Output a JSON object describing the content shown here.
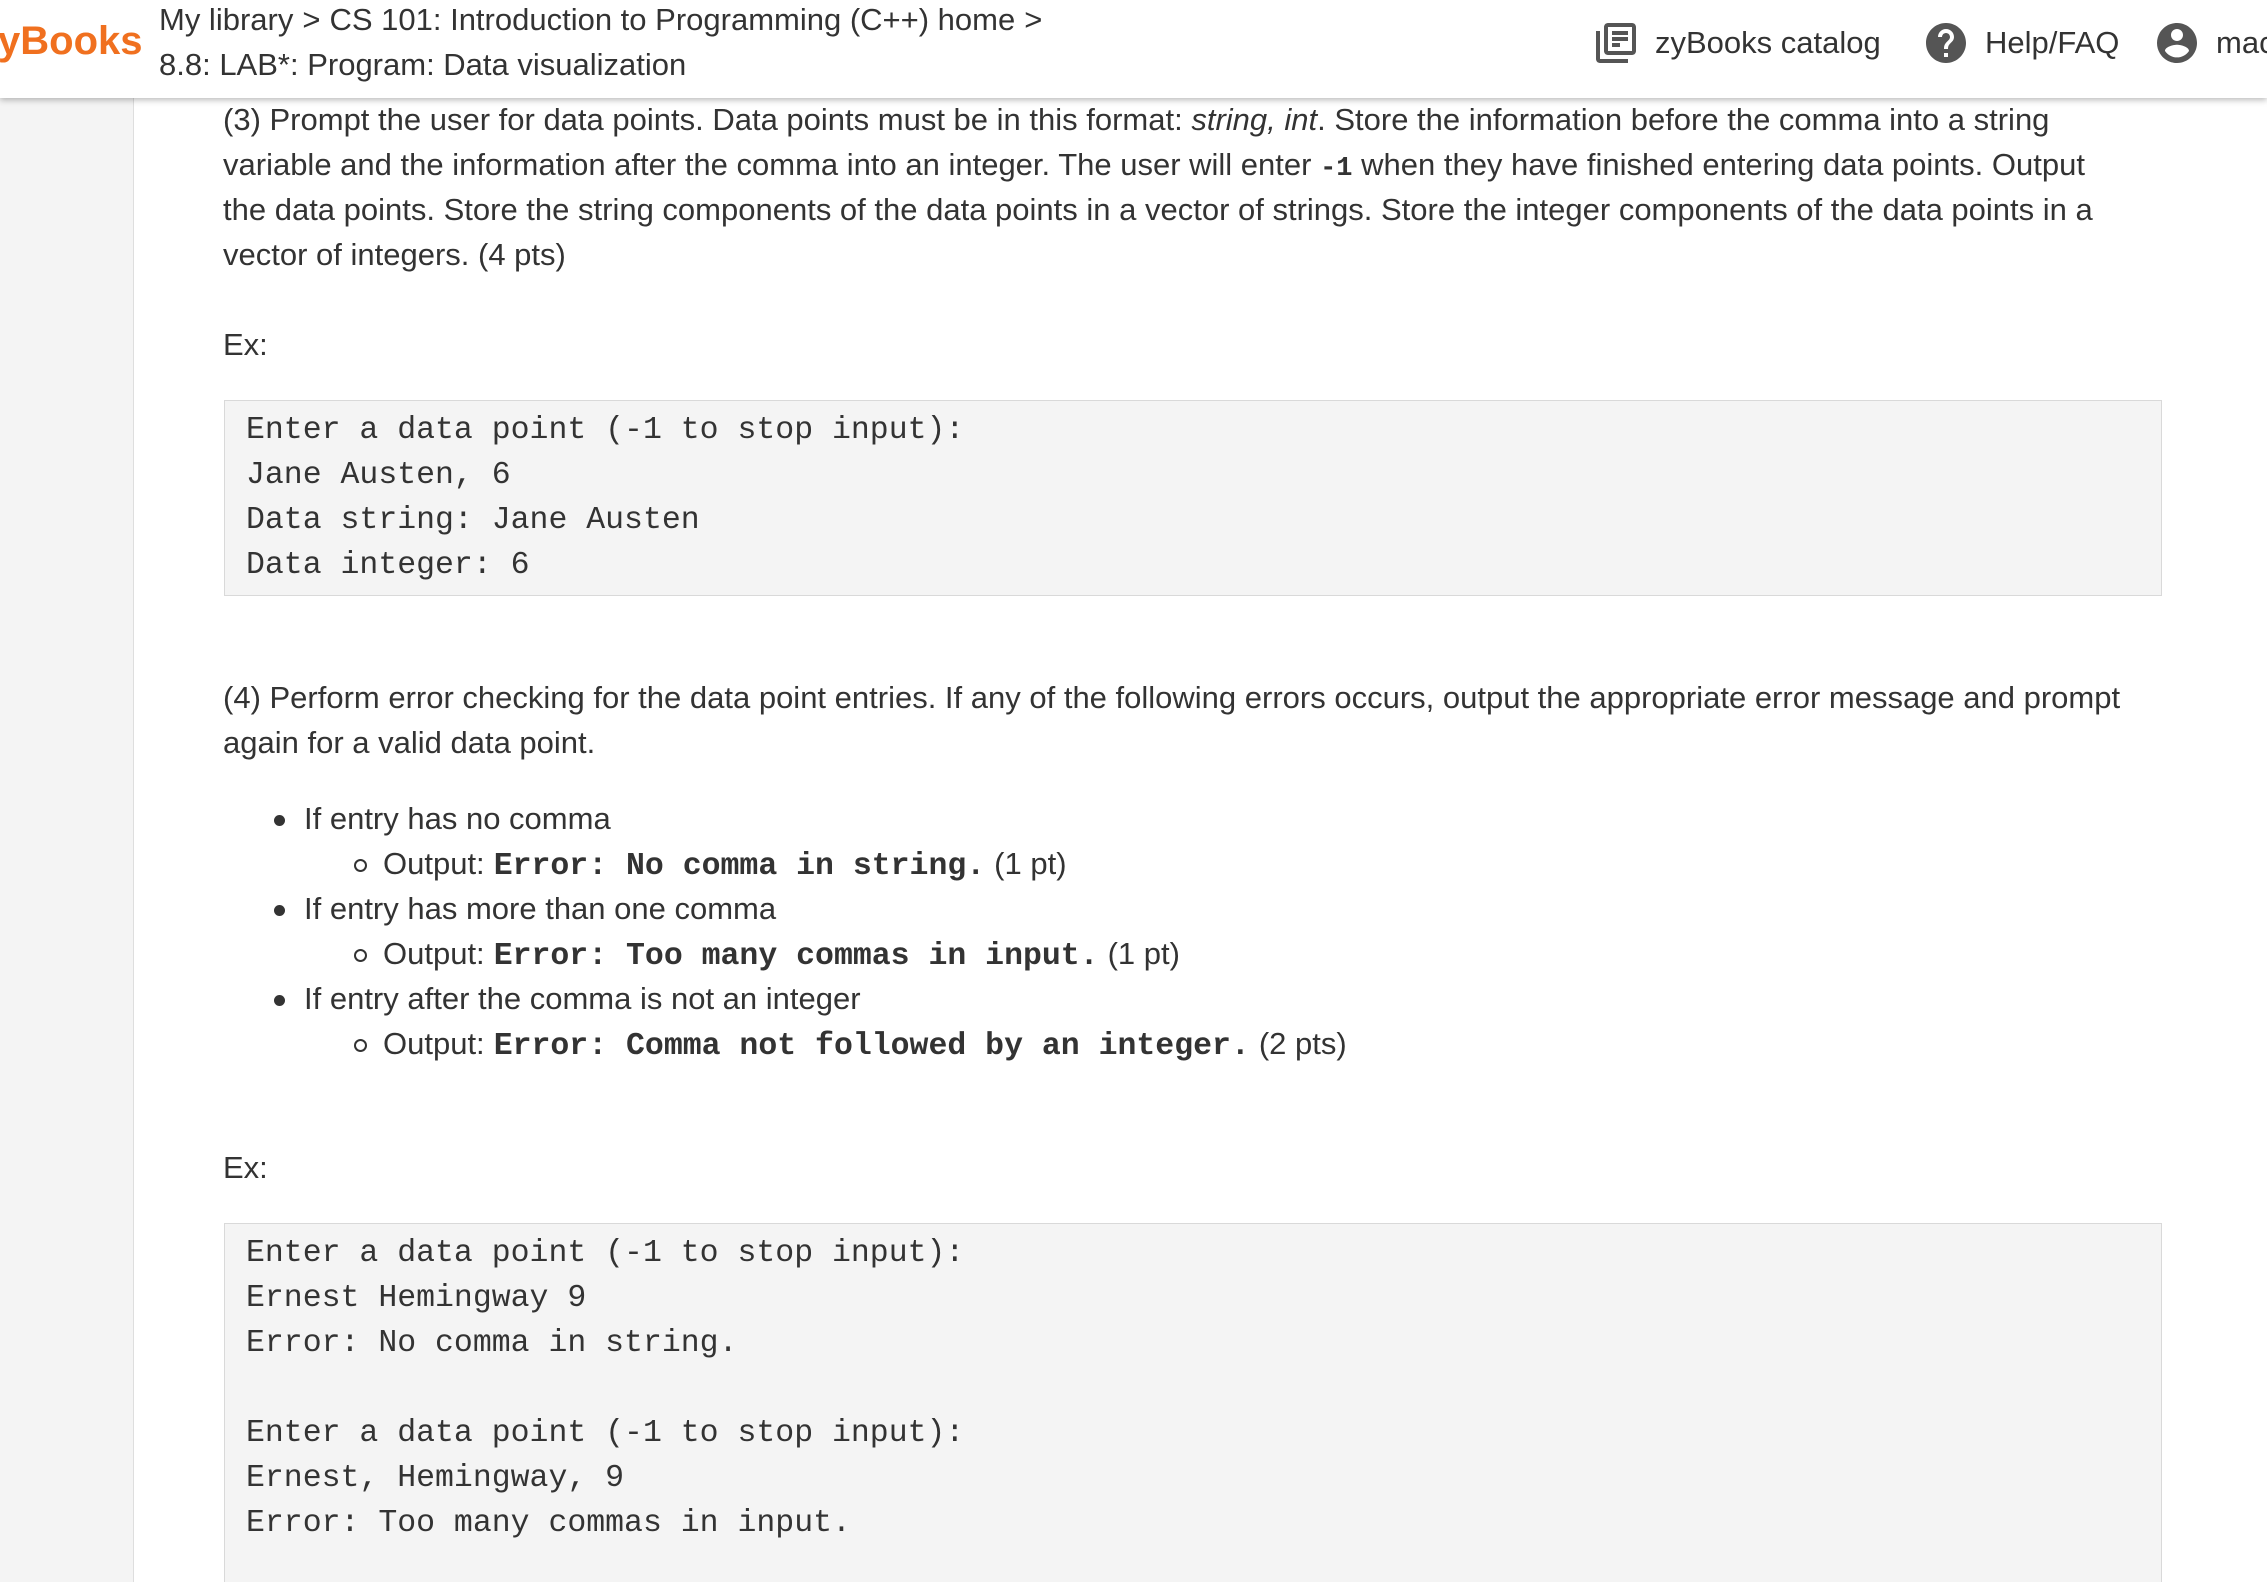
{
  "header": {
    "logo": "yBooks",
    "breadcrumb": {
      "items": [
        "My library",
        "CS 101: Introduction to Programming (C++) home"
      ],
      "separator": ">",
      "current": "8.8: LAB*: Program: Data visualization"
    },
    "nav": {
      "catalog": {
        "label": "zyBooks catalog",
        "icon": "library-books-icon"
      },
      "help": {
        "label": "Help/FAQ",
        "icon": "help-circle-icon"
      },
      "user": {
        "label": "mac",
        "icon": "account-circle-icon"
      }
    }
  },
  "colors": {
    "brand": "#f0701f",
    "text": "#333333",
    "code_background": "#f4f4f4"
  },
  "part3": {
    "line1": {
      "before": "(3) Prompt the user for data points. Data points must be in this format: ",
      "italic": "string, int",
      "after": ". Store the information before the comma into a string"
    },
    "line2": {
      "before": "variable and the information after the comma into an integer. The user will enter ",
      "code": "-1",
      "after": " when they have finished entering data points. Output"
    },
    "line3": "the data points. Store the string components of the data points in a vector of strings. Store the integer components of the data points in a",
    "line4": "vector of integers. (4 pts)"
  },
  "example1": {
    "label": "Ex:",
    "lines": [
      "Enter a data point (-1 to stop input):",
      "Jane Austen, 6",
      "Data string: Jane Austen",
      "Data integer: 6"
    ]
  },
  "part4": {
    "lines": [
      "(4) Perform error checking for the data point entries. If any of the following errors occurs, output the appropriate error message and prompt",
      "again for a valid data point."
    ],
    "errors": [
      {
        "condition": "If entry has no comma",
        "output_label": "Output:",
        "output_code": "Error: No comma in string.",
        "points": "(1 pt)"
      },
      {
        "condition": "If entry has more than one comma",
        "output_label": "Output:",
        "output_code": "Error: Too many commas in input.",
        "points": "(1 pt)"
      },
      {
        "condition": "If entry after the comma is not an integer",
        "output_label": "Output:",
        "output_code": "Error: Comma not followed by an integer.",
        "points": "(2 pts)"
      }
    ]
  },
  "example2": {
    "label": "Ex:",
    "lines": [
      "Enter a data point (-1 to stop input):",
      "Ernest Hemingway 9",
      "Error: No comma in string.",
      "",
      "Enter a data point (-1 to stop input):",
      "Ernest, Hemingway, 9",
      "Error: Too many commas in input."
    ]
  }
}
